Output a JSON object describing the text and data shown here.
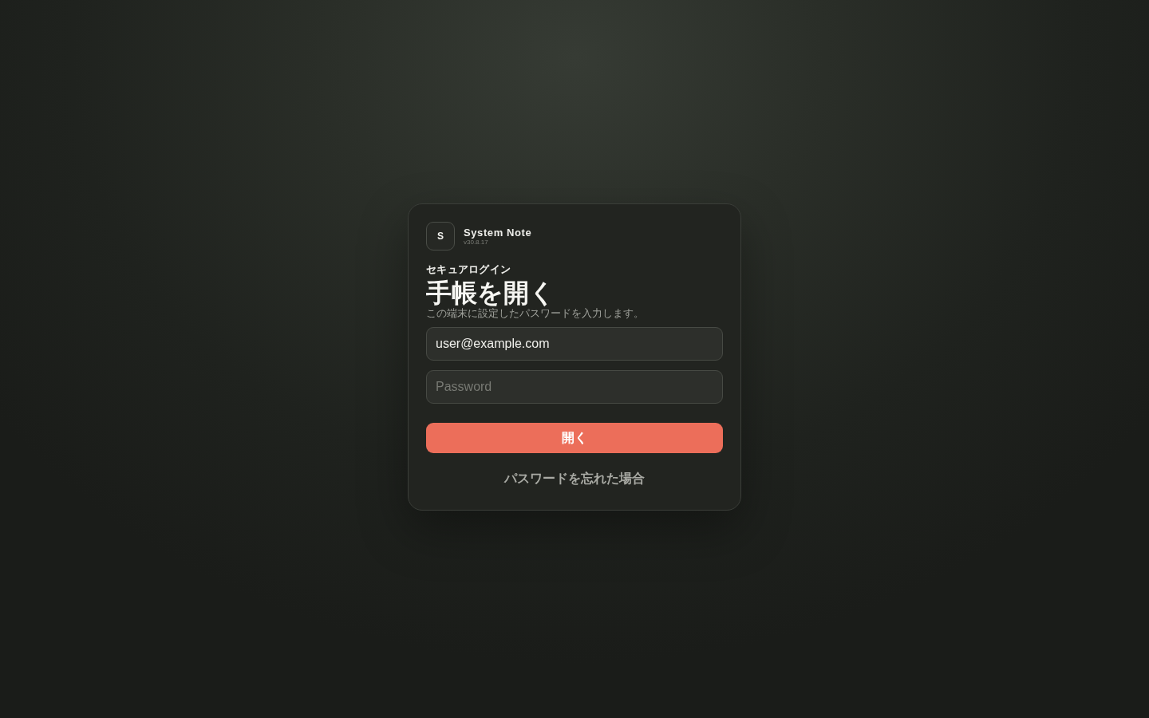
{
  "app": {
    "logo_letter": "S",
    "name": "System Note",
    "version": "v30.8.17"
  },
  "eyebrow": "セキュアログイン",
  "title": "手帳を開く",
  "subtitle": "この端末に設定したパスワードを入力します。",
  "fields": [
    {
      "kind": "email",
      "value": "user@example.com"
    },
    {
      "kind": "password",
      "placeholder": "Password"
    }
  ],
  "submit_button": "開く",
  "forgot_link": "パスワードを忘れた場合"
}
